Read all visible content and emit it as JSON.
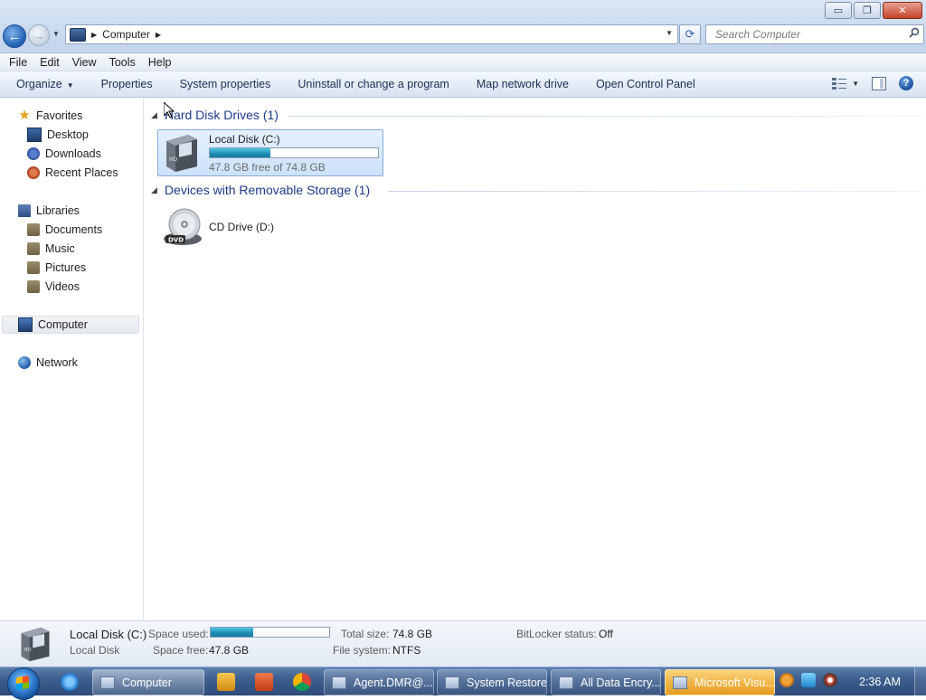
{
  "window": {
    "controls": {
      "minimize": "▭",
      "maximize": "❐",
      "close": "✕"
    }
  },
  "nav": {
    "back_glyph": "←",
    "forward_glyph": "→",
    "address": {
      "path": [
        "Computer"
      ],
      "separator": "▶"
    },
    "search": {
      "placeholder": "Search Computer",
      "value": ""
    },
    "refresh_glyph": "⟳"
  },
  "menu": [
    "File",
    "Edit",
    "View",
    "Tools",
    "Help"
  ],
  "command_bar": {
    "organize": "Organize",
    "properties": "Properties",
    "system_properties": "System properties",
    "uninstall": "Uninstall or change a program",
    "map_drive": "Map network drive",
    "control_panel": "Open Control Panel",
    "help_glyph": "?"
  },
  "sidebar": {
    "favorites": {
      "label": "Favorites",
      "icon": "star-icon",
      "children": [
        {
          "label": "Desktop",
          "icon": "desktop-icon"
        },
        {
          "label": "Downloads",
          "icon": "downloads-icon"
        },
        {
          "label": "Recent Places",
          "icon": "recent-places-icon"
        }
      ]
    },
    "libraries": {
      "label": "Libraries",
      "icon": "library-icon",
      "children": [
        {
          "label": "Documents",
          "icon": "folder-icon"
        },
        {
          "label": "Music",
          "icon": "folder-icon"
        },
        {
          "label": "Pictures",
          "icon": "folder-icon"
        },
        {
          "label": "Videos",
          "icon": "folder-icon"
        }
      ]
    },
    "computer": {
      "label": "Computer",
      "icon": "computer-icon",
      "selected": true
    },
    "network": {
      "label": "Network",
      "icon": "network-icon"
    }
  },
  "content": {
    "groups": [
      {
        "title": "Hard Disk Drives (1)",
        "items": [
          {
            "name": "Local Disk (C:)",
            "free_text": "47.8 GB free of 74.8 GB",
            "used_fraction": 0.36,
            "icon": "hard-disk-icon",
            "selected": true
          }
        ]
      },
      {
        "title": "Devices with Removable Storage (1)",
        "items": [
          {
            "name": "CD Drive (D:)",
            "icon": "dvd-drive-icon"
          }
        ]
      }
    ]
  },
  "details": {
    "name": "Local Disk (C:)",
    "type": "Local Disk",
    "space_used_label": "Space used:",
    "space_used_fraction": 0.36,
    "space_free_label": "Space free:",
    "space_free": "47.8 GB",
    "total_size_label": "Total size:",
    "total_size": "74.8 GB",
    "file_system_label": "File system:",
    "file_system": "NTFS",
    "bitlocker_label": "BitLocker status:",
    "bitlocker": "Off"
  },
  "taskbar": {
    "buttons": [
      {
        "label": "Computer",
        "active": true
      },
      {
        "label": "Agent.DMR@..."
      },
      {
        "label": "System Restore"
      },
      {
        "label": "All Data Encry..."
      },
      {
        "label": "Microsoft Visu...",
        "highlight": true
      }
    ],
    "clock": "2:36 AM"
  }
}
